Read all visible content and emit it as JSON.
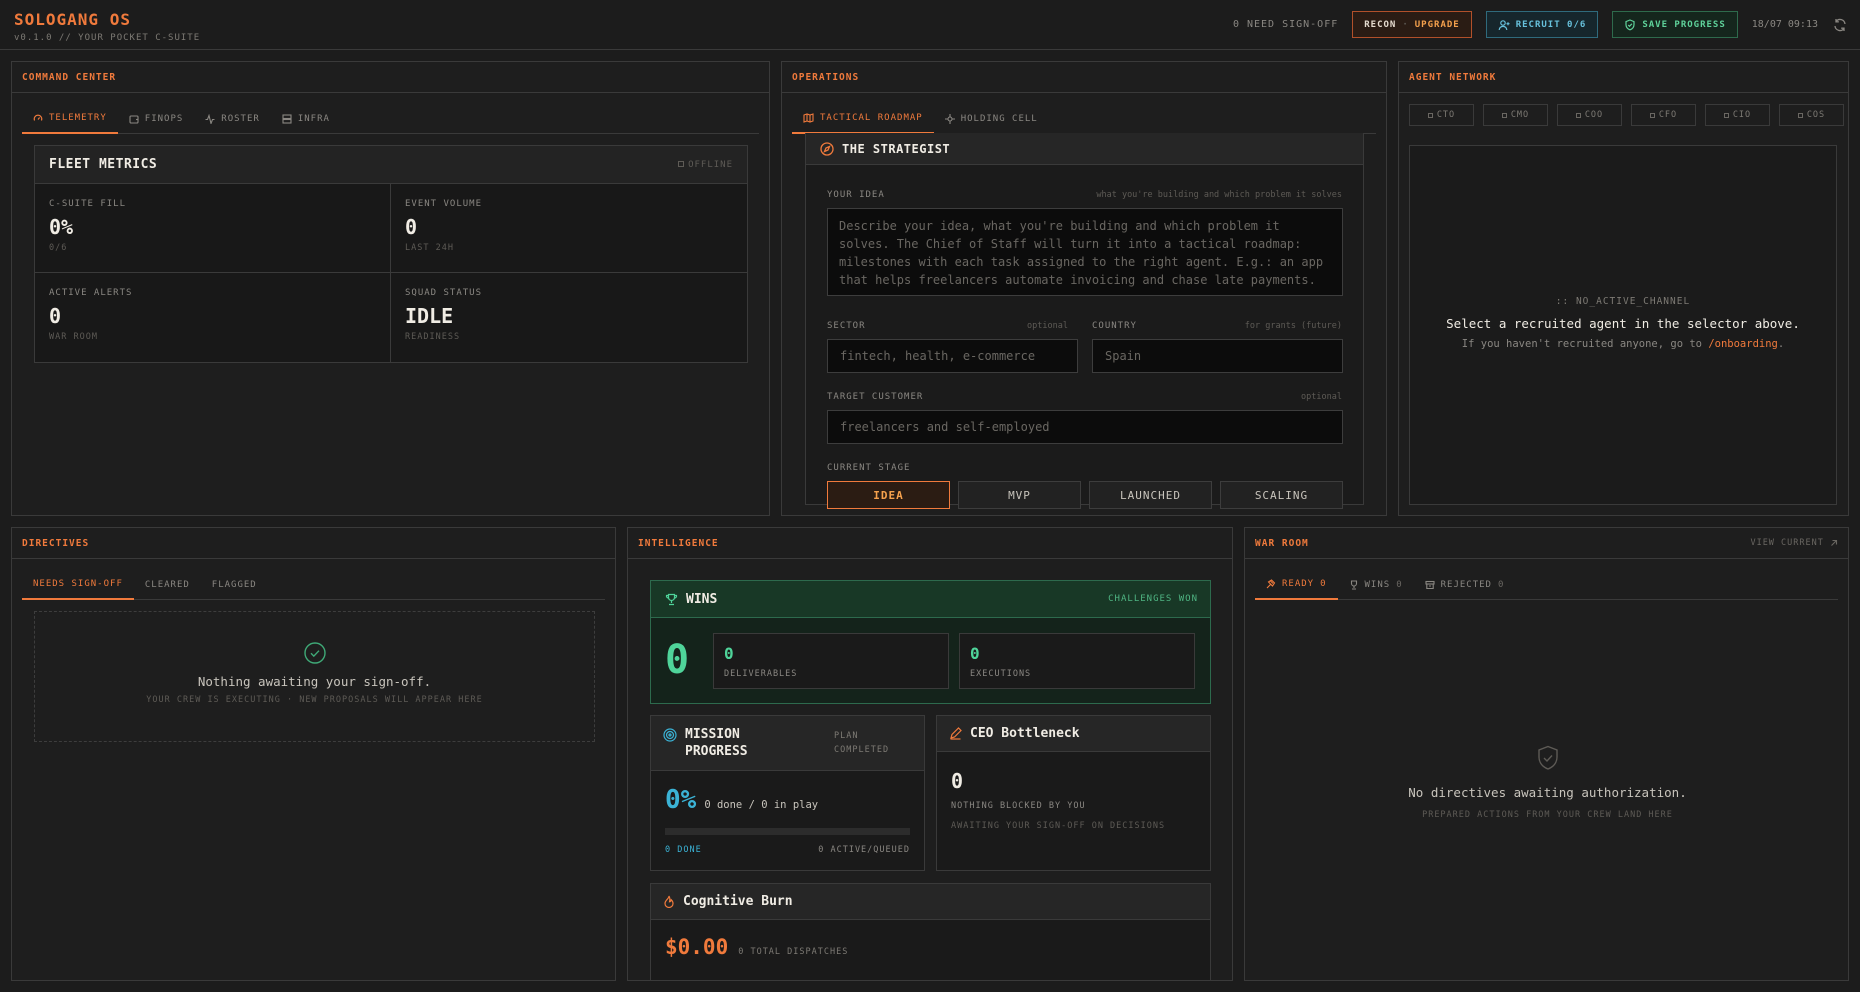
{
  "header": {
    "brand": "SOLOGANG OS",
    "version": "v0.1.0 // YOUR POCKET C-SUITE",
    "pending": "0 NEED SIGN-OFF",
    "recon_label": "RECON",
    "recon_sep": "·",
    "recon_upgrade": "UPGRADE",
    "recruit_label": "RECRUIT 0/6",
    "save_label": "SAVE PROGRESS",
    "clock": "18/07 09:13"
  },
  "command_center": {
    "title": "COMMAND CENTER",
    "tabs": [
      {
        "label": "TELEMETRY",
        "icon": "gauge-icon",
        "active": true
      },
      {
        "label": "FINOPS",
        "icon": "wallet-icon"
      },
      {
        "label": "ROSTER",
        "icon": "activity-icon"
      },
      {
        "label": "INFRA",
        "icon": "server-icon"
      }
    ],
    "fleet_title": "FLEET METRICS",
    "fleet_status": "OFFLINE",
    "metrics": [
      {
        "label": "C-SUITE FILL",
        "value": "0%",
        "sub": "0/6"
      },
      {
        "label": "EVENT VOLUME",
        "value": "0",
        "sub": "LAST 24H"
      },
      {
        "label": "ACTIVE ALERTS",
        "value": "0",
        "sub": "WAR ROOM"
      },
      {
        "label": "SQUAD STATUS",
        "value": "IDLE",
        "sub": "READINESS"
      }
    ]
  },
  "operations": {
    "title": "OPERATIONS",
    "tabs": [
      {
        "label": "TACTICAL ROADMAP",
        "icon": "map-icon",
        "active": true
      },
      {
        "label": "HOLDING CELL",
        "icon": "crosshair-icon"
      }
    ],
    "strategist_title": "THE STRATEGIST",
    "idea_label": "YOUR IDEA",
    "idea_hint": "what you're building and which problem it solves",
    "idea_placeholder": "Describe your idea, what you're building and which problem it solves. The Chief of Staff will turn it into a tactical roadmap: milestones with each task assigned to the right agent. E.g.: an app that helps freelancers automate invoicing and chase late payments.",
    "sector_label": "SECTOR",
    "sector_hint": "optional",
    "sector_placeholder": "fintech, health, e-commerce",
    "country_label": "COUNTRY",
    "country_hint": "for grants (future)",
    "country_placeholder": "Spain",
    "customer_label": "TARGET CUSTOMER",
    "customer_hint": "optional",
    "customer_placeholder": "freelancers and self-employed",
    "stage_label": "CURRENT STAGE",
    "stages": [
      "IDEA",
      "MVP",
      "LAUNCHED",
      "SCALING"
    ],
    "selected_stage": "IDEA"
  },
  "agent_network": {
    "title": "AGENT NETWORK",
    "agents": [
      "CTO",
      "CMO",
      "COO",
      "CFO",
      "CIO",
      "COS"
    ],
    "channel_code": ":: NO_ACTIVE_CHANNEL",
    "channel_msg": "Select a recruited agent in the selector above.",
    "channel_hint_pre": "If you haven't recruited anyone, go to",
    "channel_link": "/onboarding",
    "channel_hint_post": "."
  },
  "directives": {
    "title": "DIRECTIVES",
    "tabs": [
      {
        "label": "NEEDS SIGN-OFF",
        "active": true
      },
      {
        "label": "CLEARED"
      },
      {
        "label": "FLAGGED"
      }
    ],
    "empty_title": "Nothing awaiting your sign-off.",
    "empty_sub": "YOUR CREW IS EXECUTING · NEW PROPOSALS WILL APPEAR HERE"
  },
  "intelligence": {
    "title": "INTELLIGENCE",
    "wins_title": "WINS",
    "wins_tag": "CHALLENGES WON",
    "wins_total": "0",
    "deliverables_value": "0",
    "deliverables_label": "DELIVERABLES",
    "executions_value": "0",
    "executions_label": "EXECUTIONS",
    "mission_title_1": "MISSION",
    "mission_title_2": "PROGRESS",
    "mission_tag_1": "PLAN",
    "mission_tag_2": "COMPLETED",
    "mission_pct": "0%",
    "mission_detail": "0 done / 0 in play",
    "mission_progress": 0,
    "mission_done": "0 DONE",
    "mission_active": "0 ACTIVE/QUEUED",
    "ceo_title": "CEO Bottleneck",
    "ceo_value": "0",
    "ceo_label": "NOTHING BLOCKED BY YOU",
    "ceo_sub": "AWAITING YOUR SIGN-OFF ON DECISIONS",
    "burn_title": "Cognitive Burn",
    "burn_value": "$0.00",
    "burn_sub": "0 TOTAL DISPATCHES"
  },
  "war_room": {
    "title": "WAR ROOM",
    "view_current": "VIEW CURRENT",
    "tabs": [
      {
        "label": "READY",
        "count": "0",
        "active": true
      },
      {
        "label": "WINS",
        "count": "0"
      },
      {
        "label": "REJECTED",
        "count": "0"
      }
    ],
    "empty_title": "No directives awaiting authorization.",
    "empty_sub": "PREPARED ACTIONS FROM YOUR CREW LAND HERE"
  },
  "colors": {
    "accent": "#f07a3c",
    "green": "#4fd49a",
    "cyan": "#3bb3d6",
    "background": "#1c1c1c"
  }
}
